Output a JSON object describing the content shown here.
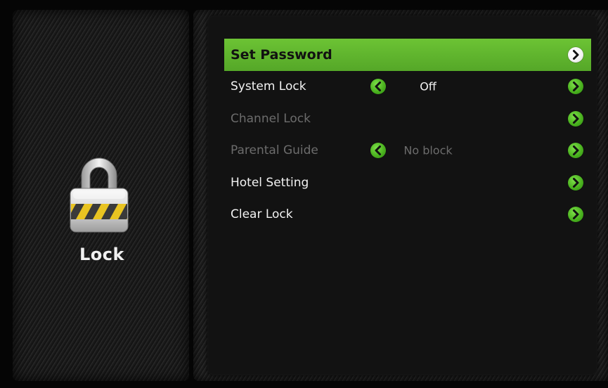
{
  "sidebar": {
    "title": "Lock",
    "icon": "padlock-icon"
  },
  "menu": {
    "items": [
      {
        "label": "Set Password",
        "value": "",
        "state": "selected"
      },
      {
        "label": "System Lock",
        "value": "Off",
        "state": "enabled"
      },
      {
        "label": "Channel Lock",
        "value": "",
        "state": "disabled"
      },
      {
        "label": "Parental Guide",
        "value": "No block",
        "state": "disabled"
      },
      {
        "label": "Hotel Setting",
        "value": "",
        "state": "enabled"
      },
      {
        "label": "Clear Lock",
        "value": "",
        "state": "enabled"
      }
    ]
  },
  "colors": {
    "highlight": "#5fb82d",
    "arrow_green": "#4bb21f",
    "text": "#f2f2f2",
    "disabled_text": "#6c6c6c"
  }
}
